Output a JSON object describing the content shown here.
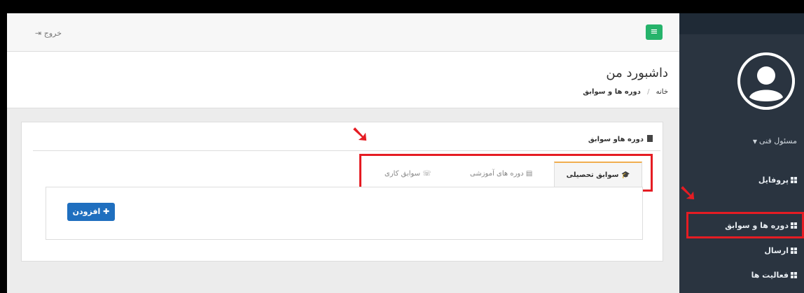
{
  "sidebar": {
    "role_label": "مسئول فنی",
    "items": [
      {
        "label": "پروفایل"
      },
      {
        "label": "دوره ها و سوابق"
      },
      {
        "label": "ارسال"
      },
      {
        "label": "فعالیت ها"
      }
    ],
    "active_index": 1
  },
  "topbar": {
    "logout_label": "خروج",
    "menu_icon": "hamburger-icon"
  },
  "header": {
    "title": "داشبورد من",
    "breadcrumb": {
      "home": "خانه",
      "separator": "/",
      "current": "دوره ها و سوابق"
    }
  },
  "panel": {
    "title": "دوره هاو سوابق",
    "tabs": [
      {
        "label": "سوابق تحصیلی",
        "icon": "graduation-cap-icon",
        "active": true
      },
      {
        "label": "دوره های آموزشی",
        "icon": "book-icon",
        "active": false
      },
      {
        "label": "سوابق کاری",
        "icon": "handshake-icon",
        "active": false
      }
    ],
    "add_button_label": "افزودن"
  },
  "colors": {
    "sidebar_bg": "#2a3440",
    "annotation_red": "#e51c23",
    "primary_button": "#1f6fbf",
    "menu_button": "#26b36b",
    "active_tab_accent": "#f0ad4e"
  }
}
